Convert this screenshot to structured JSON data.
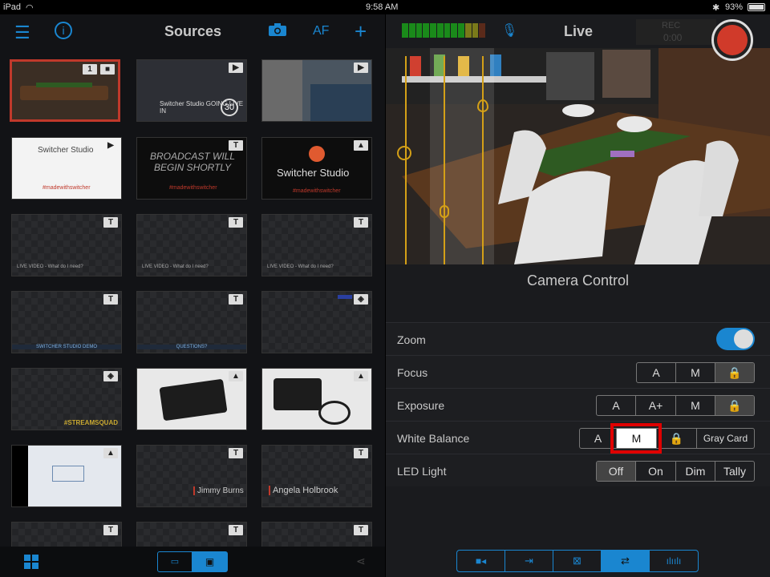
{
  "status": {
    "device": "iPad",
    "time": "9:58 AM",
    "battery": "93%"
  },
  "sources": {
    "title": "Sources",
    "af_label": "AF",
    "tiles": [
      {
        "badge": "1",
        "kind": "camera"
      },
      {
        "label": "Switcher Studio GOING LIVE IN",
        "count": "30",
        "badge": "▶"
      },
      {
        "badge": "▶"
      },
      {
        "label": "Switcher Studio",
        "sub": "#madewithswitcher",
        "badge": "▶"
      },
      {
        "label": "BROADCAST WILL BEGIN SHORTLY",
        "sub": "#madewithswitcher",
        "badge": "T"
      },
      {
        "label": "Switcher Studio",
        "sub": "#madewithswitcher",
        "badge": "image"
      },
      {
        "label": "LIVE VIDEO - What do I need?",
        "badge": "T"
      },
      {
        "label": "LIVE VIDEO - What do I need?",
        "badge": "T"
      },
      {
        "label": "LIVE VIDEO - What do I need?",
        "badge": "T"
      },
      {
        "label": "SWITCHER STUDIO DEMO",
        "badge": "T"
      },
      {
        "label": "QUESTIONS?",
        "badge": "T"
      },
      {
        "badge": "layers"
      },
      {
        "label": "#STREAMSQUAD",
        "badge": "layers"
      },
      {
        "badge": "image"
      },
      {
        "badge": "image"
      },
      {
        "badge": "image"
      },
      {
        "label": "Jimmy Burns",
        "badge": "T"
      },
      {
        "label": "Angela Holbrook",
        "badge": "T"
      }
    ]
  },
  "live": {
    "title": "Live",
    "rec": "REC",
    "timer": "0:00"
  },
  "camera_control": {
    "title": "Camera Control",
    "rows": [
      {
        "label": "Zoom"
      },
      {
        "label": "Focus",
        "options": [
          "A",
          "M",
          "🔒"
        ],
        "selected": 2
      },
      {
        "label": "Exposure",
        "options": [
          "A",
          "A+",
          "M",
          "🔒"
        ],
        "selected": 3
      },
      {
        "label": "White Balance",
        "options": [
          "A",
          "M",
          "🔒",
          "Gray Card"
        ],
        "selected": 1
      },
      {
        "label": "LED Light",
        "options": [
          "Off",
          "On",
          "Dim",
          "Tally"
        ],
        "selected": 0
      }
    ]
  }
}
